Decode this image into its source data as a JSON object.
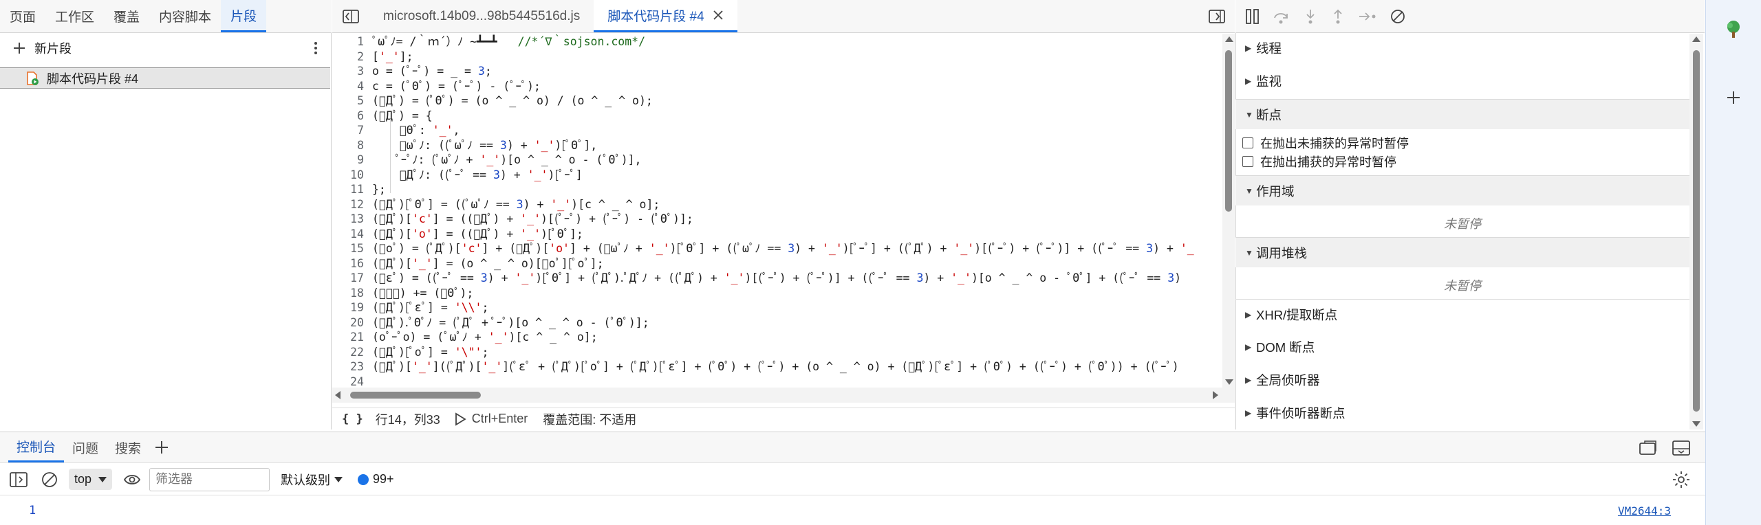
{
  "navigator": {
    "tabs": [
      {
        "label": "页面"
      },
      {
        "label": "工作区"
      },
      {
        "label": "覆盖"
      },
      {
        "label": "内容脚本"
      },
      {
        "label": "片段"
      }
    ],
    "active_tab": "片段",
    "new_snippet_label": "新片段",
    "snippets": [
      {
        "label": "脚本代码片段 #4"
      }
    ]
  },
  "editor": {
    "tabs": [
      {
        "label": "microsoft.14b09...98b5445516d.js"
      },
      {
        "label": "脚本代码片段 #4"
      }
    ],
    "line_numbers": [
      "1",
      "2",
      "3",
      "4",
      "5",
      "6",
      "7",
      "8",
      "9",
      "10",
      "11",
      "12",
      "13",
      "14",
      "15",
      "16",
      "17",
      "18",
      "19",
      "20",
      "21",
      "22",
      "23",
      "24"
    ],
    "code_lines": [
      "ﾟωﾟﾉ= /｀ｍ´）ﾉ ~┻━┻   //*´∇｀sojson.com*/",
      "['_'];",
      "o = (ﾟｰﾟ) = _ = 3;",
      "c = (ﾟΘﾟ) = (ﾟｰﾟ) - (ﾟｰﾟ);",
      "(ﾟДﾟ) = (ﾟΘﾟ) = (o ^ _ ^ o) / (o ^ _ ^ o);",
      "(ﾟДﾟ) = {",
      "    ﾟΘﾟ: '_',",
      "    ﾟωﾟﾉ: ((ﾟωﾟﾉ == 3) + '_')[ﾟΘﾟ],",
      "    ﾟｰﾟﾉ: (ﾟωﾟﾉ + '_')[o ^ _ ^ o - (ﾟΘﾟ)],",
      "    ﾟДﾟﾉ: ((ﾟｰﾟ == 3) + '_')[ﾟｰﾟ]",
      "};",
      "(ﾟДﾟ)[ﾟΘﾟ] = ((ﾟωﾟﾉ == 3) + '_')[c ^ _ ^ o];",
      "(ﾟДﾟ)['c'] = ((ﾟДﾟ) + '_')[(ﾟｰﾟ) + (ﾟｰﾟ) - (ﾟΘﾟ)];",
      "(ﾟДﾟ)['o'] = ((ﾟДﾟ) + '_')[ﾟΘﾟ];",
      "(ﾟoﾟ) = (ﾟДﾟ)['c'] + (ﾟДﾟ)['o'] + (ﾟωﾟﾉ + '_')[ﾟΘﾟ] + ((ﾟωﾟﾉ == 3) + '_')[ﾟｰﾟ] + ((ﾟДﾟ) + '_')[(ﾟｰﾟ) + (ﾟｰﾟ)] + ((ﾟｰﾟ == 3) + '_",
      "(ﾟДﾟ)['_'] = (o ^ _ ^ o)[ﾟoﾟ][ﾟoﾟ];",
      "(ﾟεﾟ) = ((ﾟｰﾟ == 3) + '_')[ﾟΘﾟ] + (ﾟДﾟ).ﾟДﾟﾉ + ((ﾟДﾟ) + '_')[(ﾟｰﾟ) + (ﾟｰﾟ)] + ((ﾟｰﾟ == 3) + '_')[o ^ _ ^ o - ﾟΘﾟ] + ((ﾟｰﾟ == 3)",
      "(ﾟｰﾟ) += (ﾟΘﾟ);",
      "(ﾟДﾟ)[ﾟεﾟ] = '\\\\';",
      "(ﾟДﾟ).ﾟΘﾟﾉ = (ﾟДﾟ + ﾟｰﾟ)[o ^ _ ^ o - (ﾟΘﾟ)];",
      "(oﾟｰﾟo) = (ﾟωﾟﾉ + '_')[c ^ _ ^ o];",
      "(ﾟДﾟ)[ﾟoﾟ] = '\\\"';",
      "(ﾟДﾟ)['_']((ﾟДﾟ)['_'](ﾟεﾟ + (ﾟДﾟ)[ﾟoﾟ] + (ﾟДﾟ)[ﾟεﾟ] + (ﾟΘﾟ) + (ﾟｰﾟ) + (o ^ _ ^ o) + (ﾟДﾟ)[ﾟεﾟ] + (ﾟΘﾟ) + ((ﾟｰﾟ) + (ﾟΘﾟ)) + ((ﾟｰﾟ)",
      ""
    ],
    "status": {
      "format_icon": "{ }",
      "cursor": "行14，列33",
      "run_shortcut": "Ctrl+Enter",
      "coverage": "覆盖范围: 不适用"
    }
  },
  "debugger": {
    "sections": {
      "threads": "线程",
      "watch": "监视",
      "breakpoints": "断点",
      "pause_uncaught": "在抛出未捕获的异常时暂停",
      "pause_caught": "在抛出捕获的异常时暂停",
      "scope": "作用域",
      "scope_note": "未暂停",
      "callstack": "调用堆栈",
      "callstack_note": "未暂停",
      "xhr": "XHR/提取断点",
      "dom": "DOM 断点",
      "global": "全局侦听器",
      "event": "事件侦听器断点"
    }
  },
  "drawer": {
    "tabs": [
      {
        "label": "控制台"
      },
      {
        "label": "问题"
      },
      {
        "label": "搜索"
      }
    ],
    "context": "top",
    "filter_placeholder": "筛选器",
    "levels": "默认级别",
    "message_count": "99+",
    "output": [
      {
        "value": "1",
        "source": "VM2644:3"
      }
    ]
  },
  "colors": {
    "accent": "#1a73e8",
    "string": "#c80000",
    "number": "#1c48c4",
    "comment": "#1f6b1f"
  }
}
